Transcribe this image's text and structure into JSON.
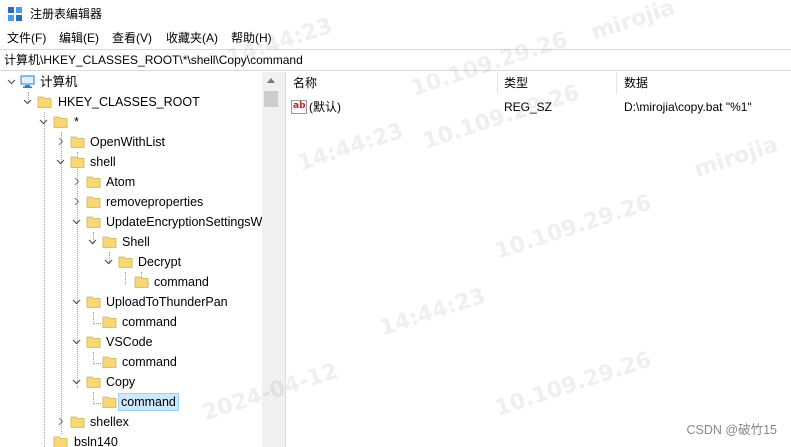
{
  "window": {
    "title": "注册表编辑器"
  },
  "menu": [
    "文件(F)",
    "编辑(E)",
    "查看(V)",
    "收藏夹(A)",
    "帮助(H)"
  ],
  "address": {
    "path": "计算机\\HKEY_CLASSES_ROOT\\*\\shell\\Copy\\command"
  },
  "tree": {
    "root": "计算机",
    "hkcr": "HKEY_CLASSES_ROOT",
    "star": "*",
    "openwithlist": "OpenWithList",
    "shell": "shell",
    "atom": "Atom",
    "removeproperties": "removeproperties",
    "updateencryption": "UpdateEncryptionSettingsW",
    "shell_sub": "Shell",
    "decrypt": "Decrypt",
    "decrypt_command": "command",
    "thunder": "UploadToThunderPan",
    "thunder_command": "command",
    "vscode": "VSCode",
    "vscode_command": "command",
    "copy": "Copy",
    "copy_command": "command",
    "shellex": "shellex",
    "next_key": "bsln140"
  },
  "list": {
    "headers": {
      "name": "名称",
      "type": "类型",
      "data": "数据"
    },
    "rows": [
      {
        "icon": "string-value-icon",
        "icon_text": "ab",
        "name": "(默认)",
        "type": "REG_SZ",
        "data": "D:\\mirojia\\copy.bat \"%1\""
      }
    ]
  },
  "watermarks": [
    "10.109.29.26",
    "14:44:23",
    "mirojia",
    "2024-04-12"
  ],
  "footer": {
    "credit": "CSDN @破竹15"
  },
  "colors": {
    "selection": "#cce8ff",
    "folder": "#f8d775",
    "folder_edge": "#d9b045",
    "computer_icon": "#2b7bd3"
  }
}
